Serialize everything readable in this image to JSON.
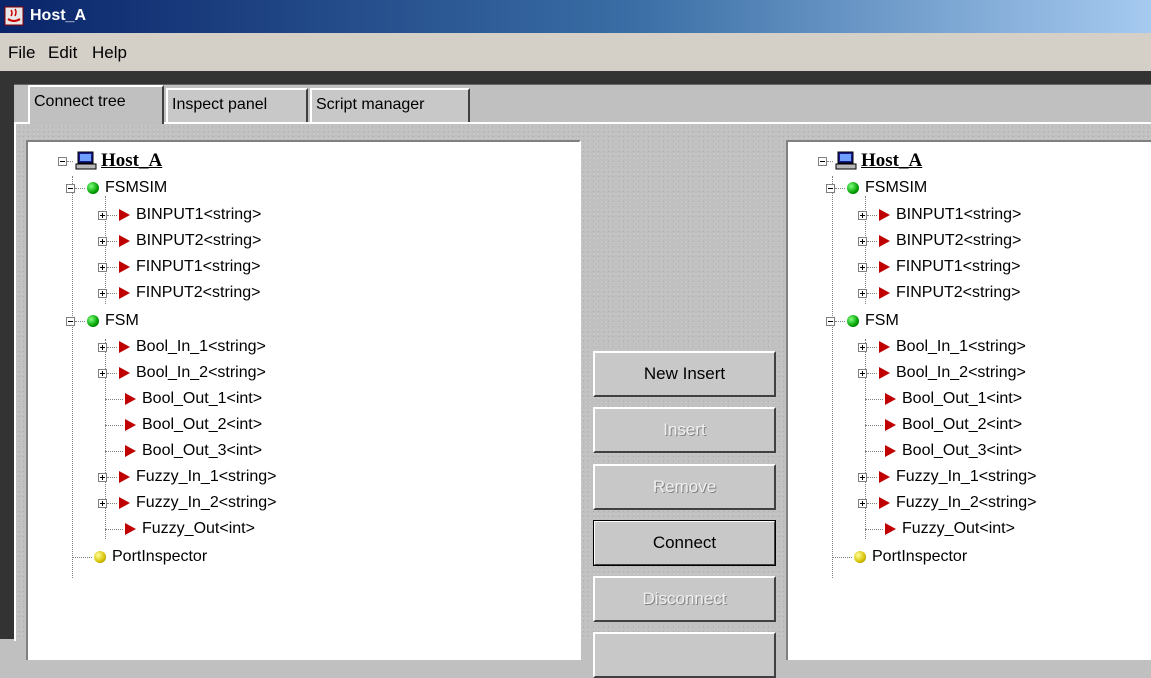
{
  "window": {
    "title": "Host_A"
  },
  "menu": [
    "File",
    "Edit",
    "Help"
  ],
  "tabs": [
    "Connect tree",
    "Inspect panel",
    "Script manager"
  ],
  "tree": {
    "host": "Host_A",
    "groups": [
      {
        "name": "FSMSIM",
        "ports": [
          "BINPUT1<string>",
          "BINPUT2<string>",
          "FINPUT1<string>",
          "FINPUT2<string>"
        ]
      },
      {
        "name": "FSM",
        "ports": [
          "Bool_In_1<string>",
          "Bool_In_2<string>",
          "Bool_Out_1<int>",
          "Bool_Out_2<int>",
          "Bool_Out_3<int>",
          "Fuzzy_In_1<string>",
          "Fuzzy_In_2<string>",
          "Fuzzy_Out<int>"
        ]
      }
    ],
    "inspector": "PortInspector"
  },
  "buttons": {
    "new_insert": "New Insert",
    "insert": "Insert",
    "remove": "Remove",
    "connect": "Connect",
    "disconnect": "Disconnect"
  }
}
